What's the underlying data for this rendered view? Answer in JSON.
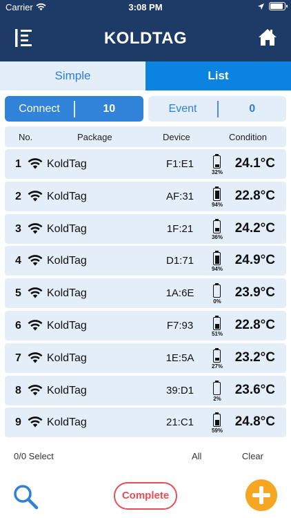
{
  "status_bar": {
    "carrier": "Carrier",
    "time": "3:08 PM"
  },
  "nav": {
    "title": "KOLDTAG",
    "menu_icon": "menu-icon",
    "home_icon": "home-icon"
  },
  "tabs": [
    {
      "label": "Simple",
      "selected": false
    },
    {
      "label": "List",
      "selected": true
    }
  ],
  "counters": {
    "connect": {
      "label": "Connect",
      "value": "10"
    },
    "event": {
      "label": "Event",
      "value": "0"
    }
  },
  "table": {
    "headers": {
      "no": "No.",
      "package": "Package",
      "device": "Device",
      "condition": "Condition"
    },
    "rows": [
      {
        "no": "1",
        "package": "KoldTag",
        "device": "F1:E1",
        "battery": "32%",
        "battery_level": 0.32,
        "temp": "24.1°C"
      },
      {
        "no": "2",
        "package": "KoldTag",
        "device": "AF:31",
        "battery": "94%",
        "battery_level": 0.94,
        "temp": "22.8°C"
      },
      {
        "no": "3",
        "package": "KoldTag",
        "device": "1F:21",
        "battery": "36%",
        "battery_level": 0.36,
        "temp": "24.2°C"
      },
      {
        "no": "4",
        "package": "KoldTag",
        "device": "D1:71",
        "battery": "94%",
        "battery_level": 0.94,
        "temp": "24.9°C"
      },
      {
        "no": "5",
        "package": "KoldTag",
        "device": "1A:6E",
        "battery": "0%",
        "battery_level": 0.0,
        "temp": "23.9°C"
      },
      {
        "no": "6",
        "package": "KoldTag",
        "device": "F7:93",
        "battery": "51%",
        "battery_level": 0.51,
        "temp": "22.8°C"
      },
      {
        "no": "7",
        "package": "KoldTag",
        "device": "1E:5A",
        "battery": "27%",
        "battery_level": 0.27,
        "temp": "23.2°C"
      },
      {
        "no": "8",
        "package": "KoldTag",
        "device": "39:D1",
        "battery": "2%",
        "battery_level": 0.02,
        "temp": "23.6°C"
      },
      {
        "no": "9",
        "package": "KoldTag",
        "device": "21:C1",
        "battery": "59%",
        "battery_level": 0.59,
        "temp": "24.8°C"
      }
    ]
  },
  "footer": {
    "select_count": "0/0 Select",
    "all_label": "All",
    "clear_label": "Clear",
    "complete_label": "Complete",
    "search_icon": "search-icon",
    "add_icon": "add-icon"
  },
  "colors": {
    "header_bg": "#1e3a66",
    "accent_blue": "#0a84e0",
    "row_bg": "#e4eef8",
    "complete_red": "#e84d55",
    "add_orange": "#f5a623"
  }
}
